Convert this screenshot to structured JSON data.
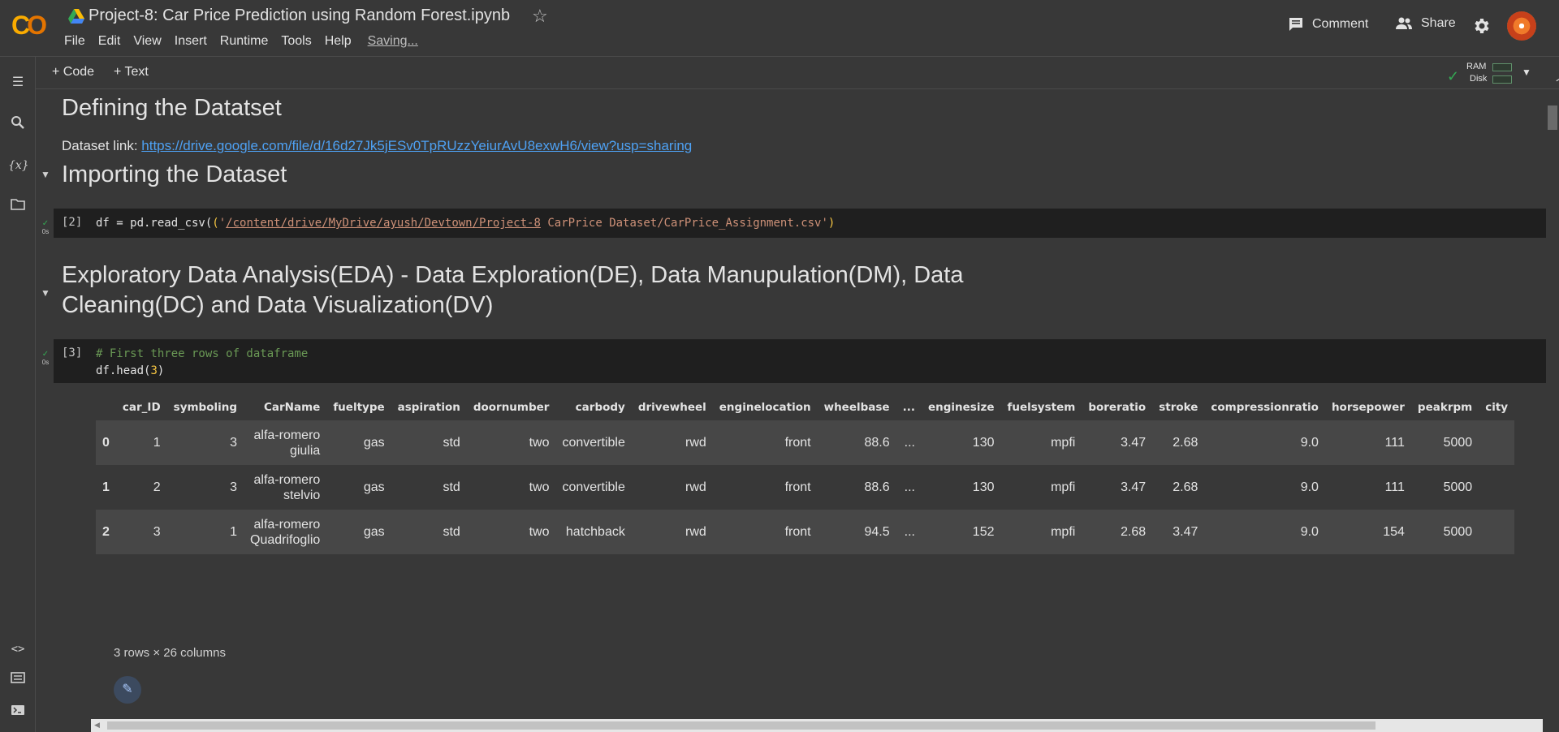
{
  "header": {
    "title": "Project-8: Car Price Prediction using Random Forest.ipynb",
    "menu": [
      "File",
      "Edit",
      "View",
      "Insert",
      "Runtime",
      "Tools",
      "Help"
    ],
    "saving": "Saving...",
    "comment_label": "Comment",
    "share_label": "Share"
  },
  "toolbar": {
    "code_label": "+ Code",
    "text_label": "+ Text",
    "ram_label": "RAM",
    "disk_label": "Disk"
  },
  "sections": {
    "s1_title": "Defining the Datatset",
    "s1_link_prefix": "Dataset link: ",
    "s1_link": "https://drive.google.com/file/d/16d27Jk5jESv0TpRUzzYeiurAvU8exwH6/view?usp=sharing",
    "s2_title": "Importing the Dataset",
    "s3_title_line1": "Exploratory Data Analysis(EDA) - Data Exploration(DE), Data Manupulation(DM), Data",
    "s3_title_line2": "Cleaning(DC) and Data Visualization(DV)"
  },
  "cell2": {
    "prompt": "[2]",
    "status": "0s",
    "code_pre": "df = pd.read_csv(",
    "code_quote_open": "'",
    "code_path": "/content/drive/MyDrive/ayush/Devtown/Project-8",
    "code_rest": " CarPrice Dataset/CarPrice_Assignment.csv'",
    "code_close": ")"
  },
  "cell3": {
    "prompt": "[3]",
    "status": "0s",
    "comment": "# First three rows of dataframe",
    "code2_pre": "df.head(",
    "code2_num": "3",
    "code2_post": ")"
  },
  "table": {
    "columns": [
      "",
      "car_ID",
      "symboling",
      "CarName",
      "fueltype",
      "aspiration",
      "doornumber",
      "carbody",
      "drivewheel",
      "enginelocation",
      "wheelbase",
      "...",
      "enginesize",
      "fuelsystem",
      "boreratio",
      "stroke",
      "compressionratio",
      "horsepower",
      "peakrpm",
      "city"
    ],
    "rows": [
      [
        "0",
        "1",
        "3",
        "alfa-romero\ngiulia",
        "gas",
        "std",
        "two",
        "convertible",
        "rwd",
        "front",
        "88.6",
        "...",
        "130",
        "mpfi",
        "3.47",
        "2.68",
        "9.0",
        "111",
        "5000",
        ""
      ],
      [
        "1",
        "2",
        "3",
        "alfa-romero\nstelvio",
        "gas",
        "std",
        "two",
        "convertible",
        "rwd",
        "front",
        "88.6",
        "...",
        "130",
        "mpfi",
        "3.47",
        "2.68",
        "9.0",
        "111",
        "5000",
        ""
      ],
      [
        "2",
        "3",
        "1",
        "alfa-romero\nQuadrifoglio",
        "gas",
        "std",
        "two",
        "hatchback",
        "rwd",
        "front",
        "94.5",
        "...",
        "152",
        "mpfi",
        "2.68",
        "3.47",
        "9.0",
        "154",
        "5000",
        ""
      ]
    ],
    "row_count": "3 rows × 26 columns"
  },
  "colors": {
    "accent_link": "#4ea1f3",
    "ok_green": "#34a853",
    "logo_orange": "#f9ab00"
  }
}
